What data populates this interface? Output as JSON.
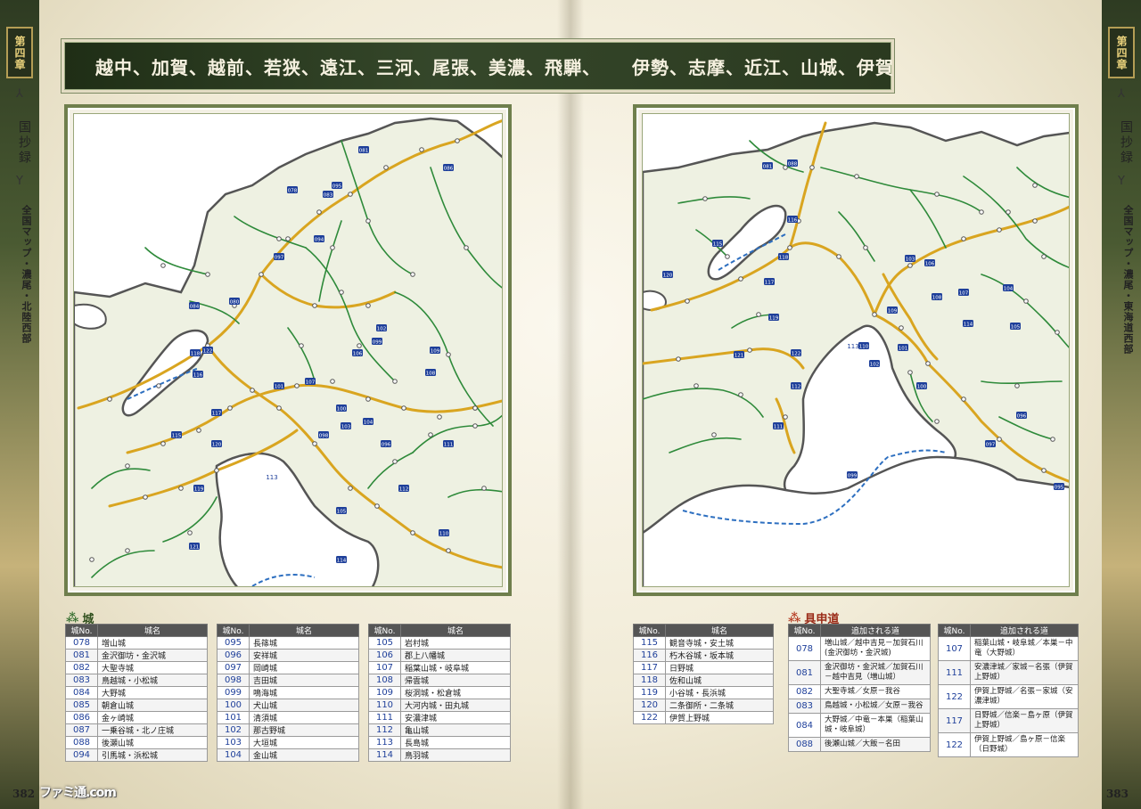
{
  "chapter_tab": "第四章",
  "sidebar": {
    "section": "国抄録",
    "left_sub": "全国マップ・濃尾・北陸西部",
    "right_sub": "全国マップ・濃尾・東海道西部"
  },
  "title": {
    "left": "越中、加賀、越前、若狭、遠江、三河、尾張、美濃、飛騨、",
    "right": "伊勢、志摩、近江、山城、伊賀"
  },
  "map_left": {
    "label_113": "113",
    "castle_numbers": [
      "081",
      "078",
      "095",
      "083",
      "094",
      "097",
      "084",
      "080",
      "118",
      "116",
      "115",
      "117",
      "120",
      "119",
      "121",
      "122",
      "101",
      "107",
      "100",
      "103",
      "099",
      "106",
      "102",
      "108",
      "096",
      "104",
      "098",
      "105",
      "109",
      "111",
      "110",
      "112",
      "114",
      "086"
    ]
  },
  "map_right": {
    "label_113": "113",
    "castle_numbers": [
      "081",
      "088",
      "115",
      "116",
      "118",
      "117",
      "119",
      "121",
      "122",
      "112",
      "111",
      "110",
      "109",
      "108",
      "106",
      "103",
      "102",
      "101",
      "100",
      "107",
      "104",
      "114",
      "105",
      "096",
      "097",
      "095",
      "099",
      "120"
    ]
  },
  "castles": {
    "title": "城",
    "headers": [
      "城No.",
      "城名"
    ],
    "table1": [
      [
        "078",
        "増山城"
      ],
      [
        "081",
        "金沢御坊・金沢城"
      ],
      [
        "082",
        "大聖寺城"
      ],
      [
        "083",
        "鳥越城・小松城"
      ],
      [
        "084",
        "大野城"
      ],
      [
        "085",
        "朝倉山城"
      ],
      [
        "086",
        "金ヶ崎城"
      ],
      [
        "087",
        "一乗谷城・北ノ庄城"
      ],
      [
        "088",
        "後瀬山城"
      ],
      [
        "094",
        "引馬城・浜松城"
      ]
    ],
    "table2": [
      [
        "095",
        "長篠城"
      ],
      [
        "096",
        "安祥城"
      ],
      [
        "097",
        "岡崎城"
      ],
      [
        "098",
        "吉田城"
      ],
      [
        "099",
        "鳴海城"
      ],
      [
        "100",
        "犬山城"
      ],
      [
        "101",
        "清須城"
      ],
      [
        "102",
        "那古野城"
      ],
      [
        "103",
        "大垣城"
      ],
      [
        "104",
        "金山城"
      ]
    ],
    "table3": [
      [
        "105",
        "岩村城"
      ],
      [
        "106",
        "郡上八幡城"
      ],
      [
        "107",
        "稲葉山城・岐阜城"
      ],
      [
        "108",
        "帰雲城"
      ],
      [
        "109",
        "桜洞城・松倉城"
      ],
      [
        "110",
        "大河内城・田丸城"
      ],
      [
        "111",
        "安濃津城"
      ],
      [
        "112",
        "亀山城"
      ],
      [
        "113",
        "長島城"
      ],
      [
        "114",
        "鳥羽城"
      ]
    ],
    "table4": [
      [
        "115",
        "観音寺城・安土城"
      ],
      [
        "116",
        "朽木谷城・坂本城"
      ],
      [
        "117",
        "日野城"
      ],
      [
        "118",
        "佐和山城"
      ],
      [
        "119",
        "小谷城・長浜城"
      ],
      [
        "120",
        "二条御所・二条城"
      ],
      [
        "122",
        "伊賀上野城"
      ]
    ]
  },
  "gushindo": {
    "title": "具申道",
    "headers": [
      "城No.",
      "追加される道"
    ],
    "table5": [
      [
        "078",
        "増山城／越中吉見－加賀石川 (金沢御坊・金沢城)"
      ],
      [
        "081",
        "金沢御坊・金沢城／加賀石川－越中吉見（増山城）"
      ],
      [
        "082",
        "大聖寺城／女原－我谷"
      ],
      [
        "083",
        "鳥越城・小松城／女原－我谷"
      ],
      [
        "084",
        "大野城／中竜－本巣（稲葉山城・岐阜城）"
      ],
      [
        "088",
        "後瀬山城／大飯－名田"
      ]
    ],
    "table6": [
      [
        "107",
        "稲葉山城・岐阜城／本巣－中竜（大野城）"
      ],
      [
        "111",
        "安濃津城／家城－名張（伊賀上野城）"
      ],
      [
        "122",
        "伊賀上野城／名張－家城（安濃津城）"
      ],
      [
        "117",
        "日野城／信楽－島ヶ原（伊賀上野城）"
      ],
      [
        "122",
        "伊賀上野城／島ヶ原－信楽（日野城）"
      ]
    ]
  },
  "pages": {
    "left": "382",
    "right": "383"
  },
  "watermark": "ファミ通.com",
  "colors": {
    "road_main": "#d9a520",
    "road_branch": "#2e8a3a",
    "land": "#eef1e2",
    "water": "#ffffff",
    "coast": "#555555",
    "castle_marker": "#1e3f9a",
    "title_band": "#2b3a20"
  }
}
